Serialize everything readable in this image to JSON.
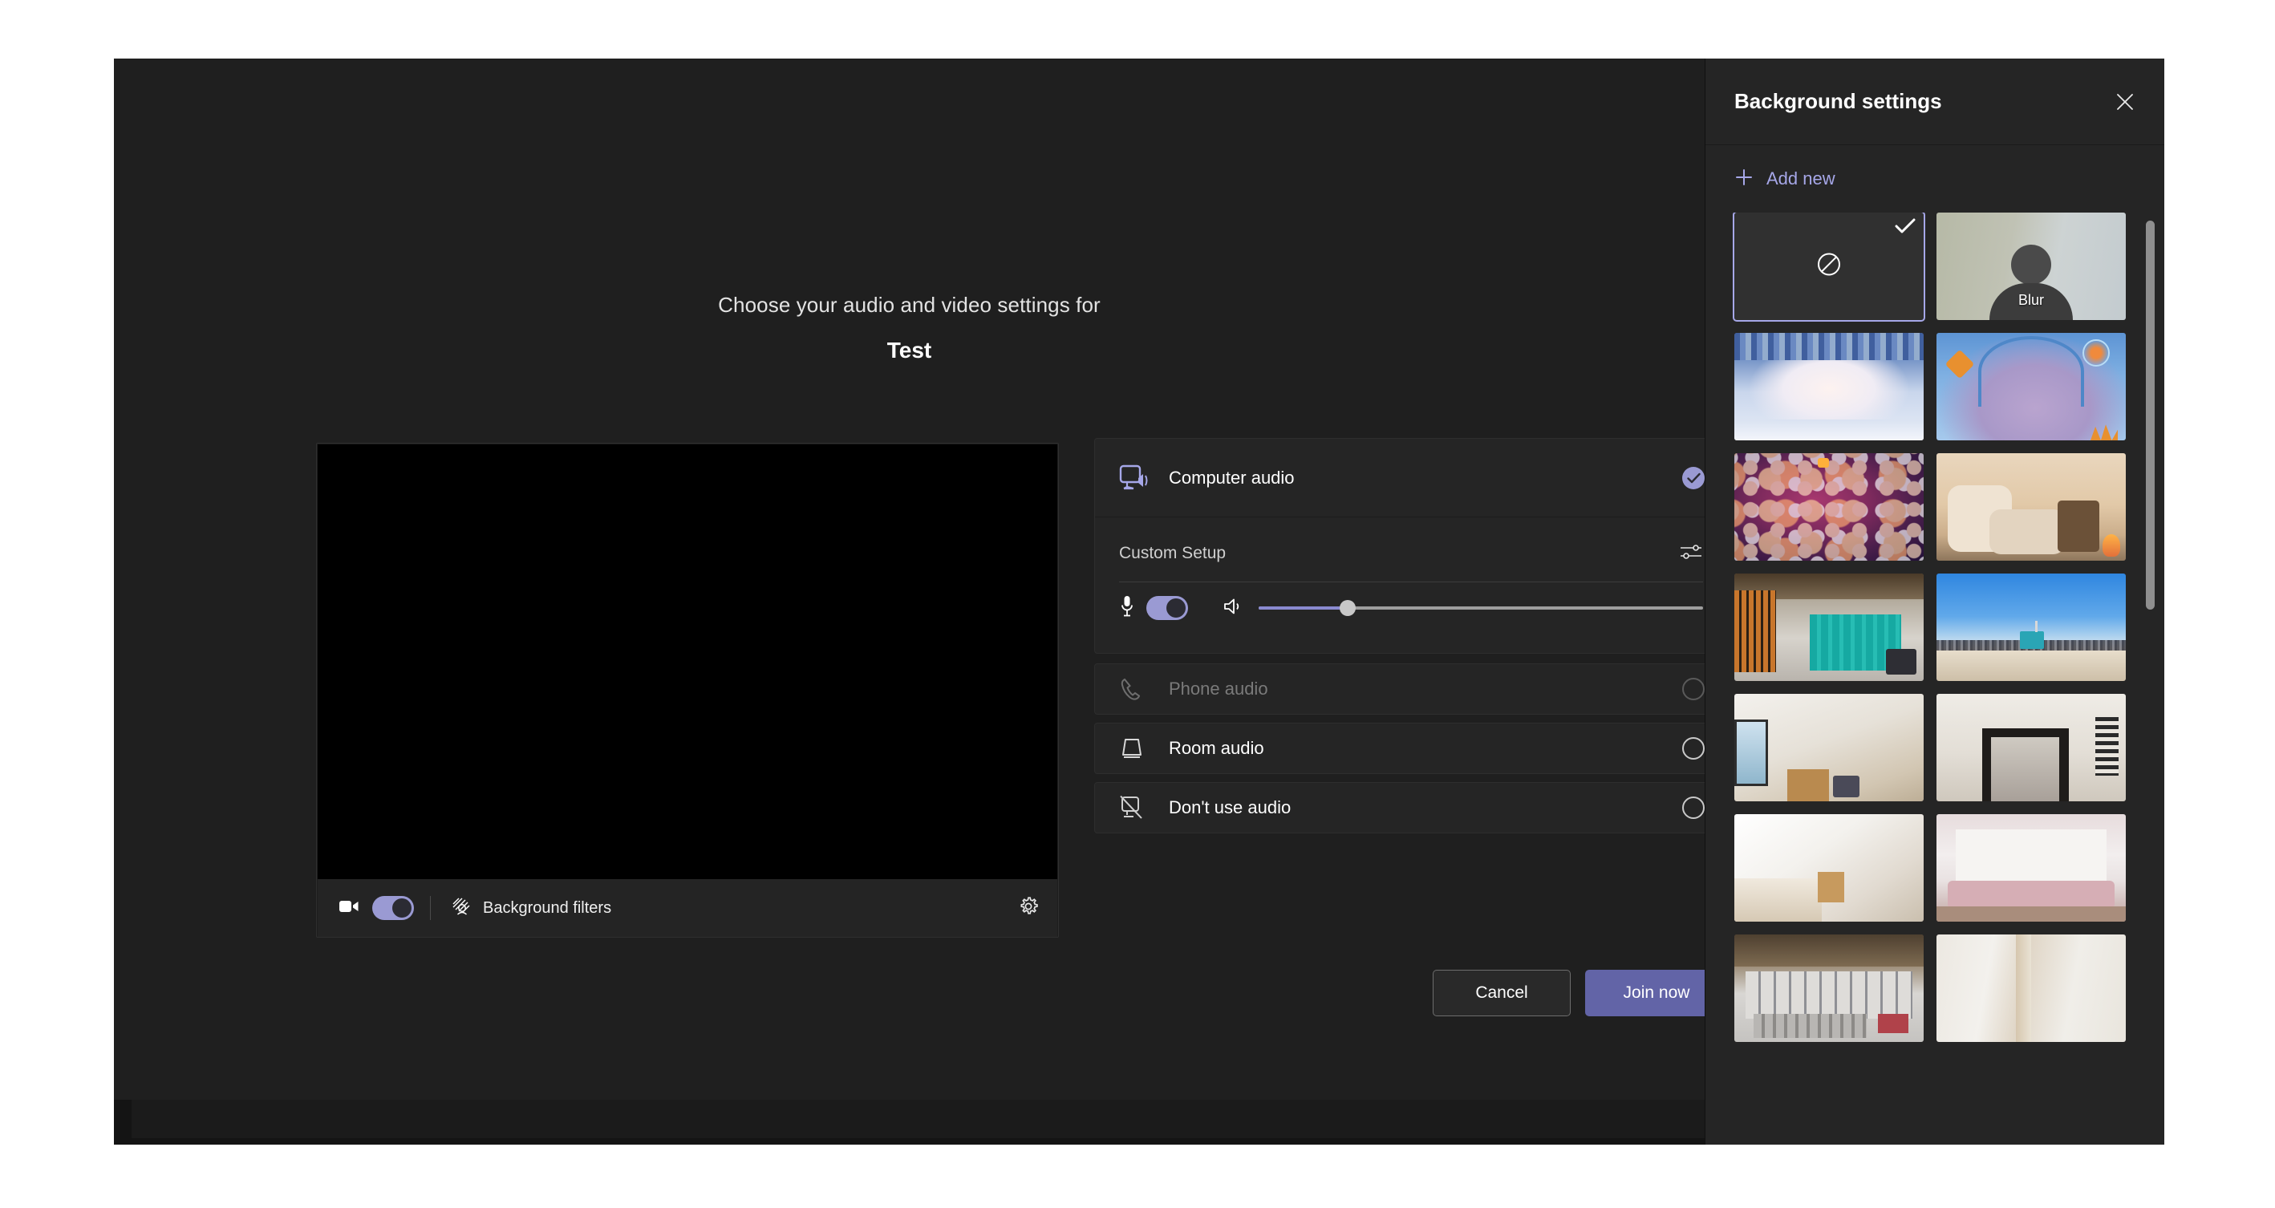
{
  "window": {
    "background_color": "#1f1f1f"
  },
  "prejoin": {
    "heading": "Choose your audio and video settings for",
    "meeting_title": "Test",
    "video": {
      "camera_toggle_state": "on",
      "camera_icon": "video-camera-icon",
      "background_filters_label": "Background filters",
      "background_filters_icon": "background-filters-icon",
      "settings_icon": "gear-icon"
    },
    "audio_options": [
      {
        "id": "computer-audio",
        "label": "Computer audio",
        "icon": "computer-speaker-icon",
        "selected": true,
        "disabled": false
      },
      {
        "id": "phone-audio",
        "label": "Phone audio",
        "icon": "phone-handset-icon",
        "selected": false,
        "disabled": true
      },
      {
        "id": "room-audio",
        "label": "Room audio",
        "icon": "room-speaker-icon",
        "selected": false,
        "disabled": false
      },
      {
        "id": "dont-use-audio",
        "label": "Don't use audio",
        "icon": "no-audio-device-icon",
        "selected": false,
        "disabled": false
      }
    ],
    "custom_setup": {
      "label": "Custom Setup",
      "settings_icon": "audio-sliders-icon",
      "mic_icon": "microphone-icon",
      "mic_toggle_state": "on",
      "speaker_icon": "speaker-icon",
      "volume_percent": 20
    },
    "buttons": {
      "cancel": "Cancel",
      "join_now": "Join now"
    }
  },
  "background_panel": {
    "title": "Background settings",
    "close_icon": "close-icon",
    "add_new": {
      "label": "Add new",
      "icon": "plus-icon"
    },
    "accent_color": "#a6a7e8",
    "thumbnails": [
      {
        "id": "none",
        "label": "None",
        "selected": true,
        "kind": "none",
        "colors": [
          "#303030",
          "#303030"
        ]
      },
      {
        "id": "blur",
        "label": "Blur",
        "selected": false,
        "kind": "blur",
        "colors": [
          "#b6b9a6",
          "#c9cfce"
        ]
      },
      {
        "id": "winter-cave",
        "label": "",
        "selected": false,
        "kind": "image",
        "colors": [
          "#4f6fa8",
          "#e7e3ee"
        ]
      },
      {
        "id": "winter-arch",
        "label": "",
        "selected": false,
        "kind": "image",
        "colors": [
          "#5d94d4",
          "#b29ccd"
        ]
      },
      {
        "id": "confetti",
        "label": "",
        "selected": false,
        "kind": "image",
        "colors": [
          "#8e2b63",
          "#2a1640"
        ]
      },
      {
        "id": "cozy-sofa",
        "label": "",
        "selected": false,
        "kind": "image",
        "colors": [
          "#e4cdb2",
          "#c8a98a"
        ]
      },
      {
        "id": "office-teal",
        "label": "",
        "selected": false,
        "kind": "image",
        "colors": [
          "#b98b4f",
          "#1aa9a2"
        ]
      },
      {
        "id": "beach-sky",
        "label": "",
        "selected": false,
        "kind": "image",
        "colors": [
          "#3f8fe0",
          "#d8cdbb"
        ]
      },
      {
        "id": "bright-room",
        "label": "",
        "selected": false,
        "kind": "image",
        "colors": [
          "#e8e4dd",
          "#cbb79c"
        ]
      },
      {
        "id": "doorway",
        "label": "",
        "selected": false,
        "kind": "image",
        "colors": [
          "#e3ded6",
          "#8c8179"
        ]
      },
      {
        "id": "white-room",
        "label": "",
        "selected": false,
        "kind": "image",
        "colors": [
          "#f2f0ec",
          "#d8cfc2"
        ]
      },
      {
        "id": "pink-lounge",
        "label": "",
        "selected": false,
        "kind": "image",
        "colors": [
          "#ede8e8",
          "#c9a9ae"
        ]
      },
      {
        "id": "loft-lab",
        "label": "",
        "selected": false,
        "kind": "image",
        "colors": [
          "#8d7a60",
          "#d9d9d9"
        ]
      },
      {
        "id": "plain-wall",
        "label": "",
        "selected": false,
        "kind": "image",
        "colors": [
          "#efece7",
          "#e0d8cb"
        ]
      }
    ],
    "scrollbar": {
      "visible": true
    }
  }
}
